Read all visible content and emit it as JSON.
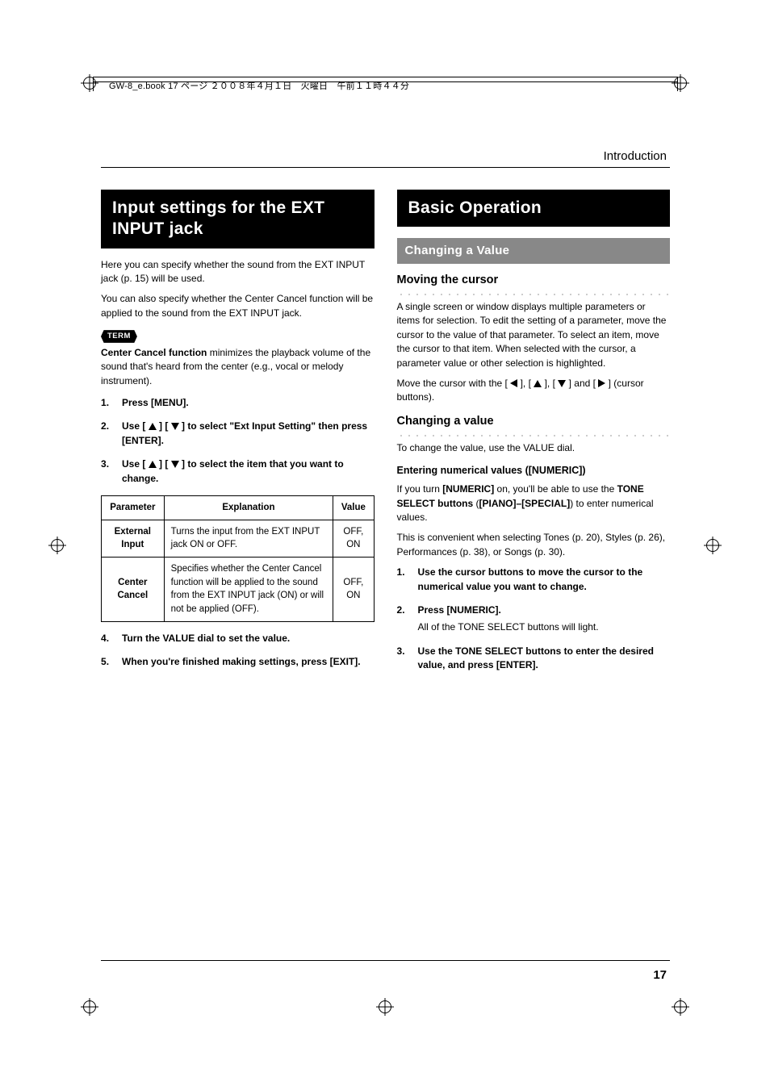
{
  "running_header": "GW-8_e.book 17 ページ ２００８年４月１日　火曜日　午前１１時４４分",
  "chapter": "Introduction",
  "page_number": "17",
  "left": {
    "h1": "Input settings for the EXT INPUT jack",
    "p1": "Here you can specify whether the sound from the EXT INPUT jack (p. 15) will be used.",
    "p2": "You can also specify whether the Center Cancel function will be applied to the sound from the EXT INPUT jack.",
    "term_tag": "TERM",
    "term_body_bold": "Center Cancel function",
    "term_body_rest": " minimizes the playback volume of the sound that's heard from the center (e.g., vocal or melody instrument).",
    "steps": {
      "s1": "Press [MENU].",
      "s2_pre": "Use [ ",
      "s2_mid": " ] [ ",
      "s2_post": " ] to select \"Ext Input Setting\" then press [ENTER].",
      "s3_pre": "Use [ ",
      "s3_mid": " ] [ ",
      "s3_post": " ] to select the item that you want to change.",
      "s4": "Turn the VALUE dial to set the value.",
      "s5": "When you're finished making settings, press [EXIT]."
    },
    "table": {
      "headers": {
        "p": "Parameter",
        "e": "Explanation",
        "v": "Value"
      },
      "rows": [
        {
          "param": "External Input",
          "expl": "Turns the input from the EXT INPUT jack ON or OFF.",
          "val": "OFF, ON"
        },
        {
          "param": "Center Cancel",
          "expl": "Specifies whether the Center Cancel function will be applied to the sound from the EXT INPUT jack (ON) or will not be applied (OFF).",
          "val": "OFF, ON"
        }
      ]
    }
  },
  "right": {
    "h1": "Basic Operation",
    "h2": "Changing a Value",
    "sec1": {
      "title": "Moving the cursor",
      "p1": "A single screen or window displays multiple parameters or items for selection. To edit the setting of a parameter, move the cursor to the value of that parameter. To select an item, move the cursor to that item. When selected with the cursor, a parameter value or other selection is highlighted.",
      "p2_pre": "Move the cursor with the [ ",
      "p2_a": " ], [ ",
      "p2_b": " ], [ ",
      "p2_c": " ] and [ ",
      "p2_post": " ] (cursor buttons)."
    },
    "sec2": {
      "title": "Changing a value",
      "p1": "To change the value, use the VALUE dial.",
      "sub_title": "Entering numerical values ([NUMERIC])",
      "p2_a": "If you turn ",
      "p2_b": "[NUMERIC]",
      "p2_c": " on, you'll be able to use the ",
      "p2_d": "TONE SELECT buttons",
      "p2_e": " (",
      "p2_f": "[PIANO]–[SPECIAL]",
      "p2_g": ") to enter numerical values.",
      "p3": "This is convenient when selecting Tones (p. 20), Styles (p. 26), Performances (p. 38), or Songs (p. 30).",
      "steps": {
        "s1": "Use the cursor buttons to move the cursor to the numerical value you want to change.",
        "s2": "Press [NUMERIC].",
        "s2_note": "All of the TONE SELECT buttons will light.",
        "s3": "Use the TONE SELECT buttons to enter the desired value, and press [ENTER]."
      }
    }
  }
}
